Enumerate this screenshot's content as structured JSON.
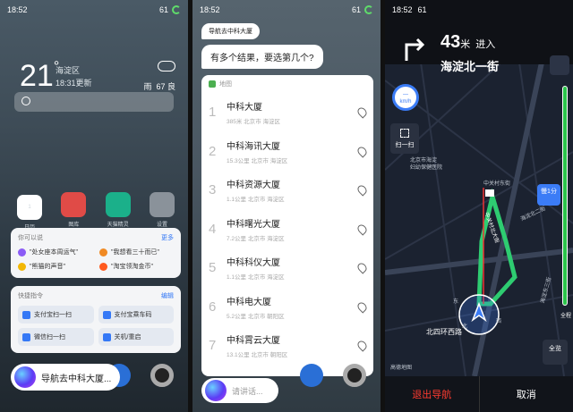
{
  "p1": {
    "status_time": "18:52",
    "battery": "61",
    "temperature": "21",
    "location": "海淀区",
    "updated": "18:31更新",
    "weather": "雨",
    "aqi": "67 良",
    "apps": [
      {
        "label": "日历",
        "date": "1",
        "color": "#ffffff"
      },
      {
        "label": "图库",
        "color": "#e04b47"
      },
      {
        "label": "天猫精灵",
        "color": "#1bb08a"
      },
      {
        "label": "设置",
        "color": "#8a929a"
      }
    ],
    "sug_title": "你可以说",
    "sug_more": "更多",
    "suggestions": [
      {
        "text": "\"处女座本周运气\"",
        "color": "#8b5cf6"
      },
      {
        "text": "\"我想看三十而已\"",
        "color": "#f08a24"
      },
      {
        "text": "\"熊猫的声音\"",
        "color": "#f2b705"
      },
      {
        "text": "\"淘宝领淘金币\"",
        "color": "#ff5a1f"
      }
    ],
    "quick_title": "快捷指令",
    "quick_edit": "编辑",
    "quick": [
      "支付宝扫一扫",
      "支付宝乘车码",
      "微信扫一扫",
      "关机/重启"
    ],
    "bubble_text": "导航去中科大厦..."
  },
  "p2": {
    "status_time": "18:52",
    "battery": "61",
    "user_query": "导航去中科大厦",
    "assistant_reply": "有多个结果，要选第几个?",
    "map_label": "地图",
    "results": [
      {
        "n": "1",
        "name": "中科大厦",
        "info": "385米  北京市  海淀区"
      },
      {
        "n": "2",
        "name": "中科海讯大厦",
        "info": "15.3公里  北京市  海淀区"
      },
      {
        "n": "3",
        "name": "中科资源大厦",
        "info": "1.1公里  北京市  海淀区"
      },
      {
        "n": "4",
        "name": "中科曙光大厦",
        "info": "7.2公里  北京市  海淀区"
      },
      {
        "n": "5",
        "name": "中科科仪大厦",
        "info": "1.1公里  北京市  海淀区"
      },
      {
        "n": "6",
        "name": "中科电大厦",
        "info": "5.2公里  北京市  朝阳区"
      },
      {
        "n": "7",
        "name": "中科霄云大厦",
        "info": "13.1公里  北京市  朝阳区"
      }
    ],
    "input_placeholder": "请讲话..."
  },
  "p3": {
    "status_time": "18:52",
    "battery": "61",
    "distance": "43",
    "distance_unit": "米",
    "action": "进入",
    "street": "海淀北一街",
    "speed_unit": "km/h",
    "scan_label": "扫一扫",
    "slow_label": "慢1分",
    "full_label": "全程",
    "overview_label": "全览",
    "map_labels": [
      "北京市海淀",
      "妇幼保健医院",
      "中关村东街",
      "海淀北二街",
      "北四环西路",
      "海淀东三街",
      "高德地图",
      "东",
      "西",
      "北",
      "中关村北大街"
    ],
    "exit_nav": "退出导航",
    "cancel": "取消"
  }
}
